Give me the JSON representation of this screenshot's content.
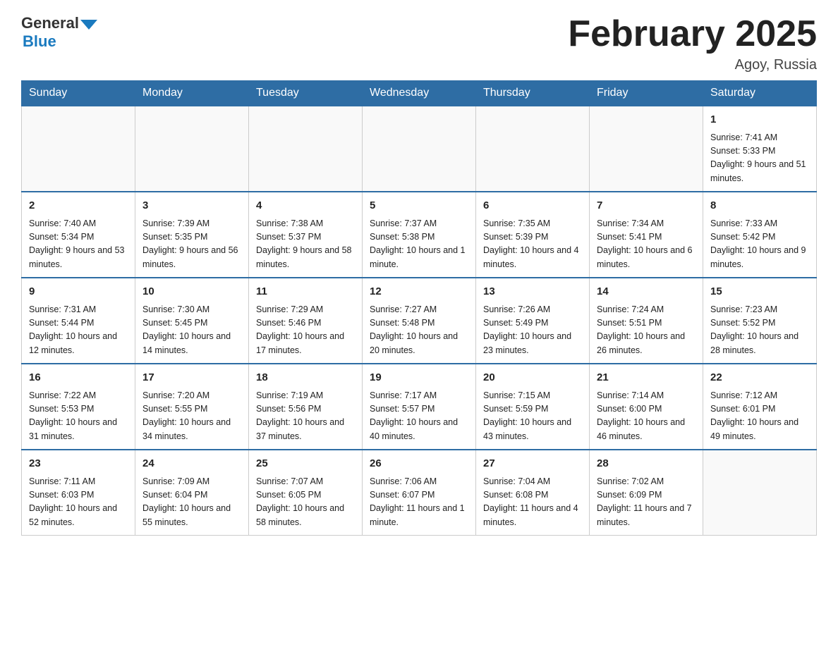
{
  "logo": {
    "general": "General",
    "blue": "Blue"
  },
  "title": "February 2025",
  "subtitle": "Agoy, Russia",
  "days_of_week": [
    "Sunday",
    "Monday",
    "Tuesday",
    "Wednesday",
    "Thursday",
    "Friday",
    "Saturday"
  ],
  "weeks": [
    [
      {
        "day": "",
        "info": ""
      },
      {
        "day": "",
        "info": ""
      },
      {
        "day": "",
        "info": ""
      },
      {
        "day": "",
        "info": ""
      },
      {
        "day": "",
        "info": ""
      },
      {
        "day": "",
        "info": ""
      },
      {
        "day": "1",
        "info": "Sunrise: 7:41 AM\nSunset: 5:33 PM\nDaylight: 9 hours\nand 51 minutes."
      }
    ],
    [
      {
        "day": "2",
        "info": "Sunrise: 7:40 AM\nSunset: 5:34 PM\nDaylight: 9 hours\nand 53 minutes."
      },
      {
        "day": "3",
        "info": "Sunrise: 7:39 AM\nSunset: 5:35 PM\nDaylight: 9 hours\nand 56 minutes."
      },
      {
        "day": "4",
        "info": "Sunrise: 7:38 AM\nSunset: 5:37 PM\nDaylight: 9 hours\nand 58 minutes."
      },
      {
        "day": "5",
        "info": "Sunrise: 7:37 AM\nSunset: 5:38 PM\nDaylight: 10 hours\nand 1 minute."
      },
      {
        "day": "6",
        "info": "Sunrise: 7:35 AM\nSunset: 5:39 PM\nDaylight: 10 hours\nand 4 minutes."
      },
      {
        "day": "7",
        "info": "Sunrise: 7:34 AM\nSunset: 5:41 PM\nDaylight: 10 hours\nand 6 minutes."
      },
      {
        "day": "8",
        "info": "Sunrise: 7:33 AM\nSunset: 5:42 PM\nDaylight: 10 hours\nand 9 minutes."
      }
    ],
    [
      {
        "day": "9",
        "info": "Sunrise: 7:31 AM\nSunset: 5:44 PM\nDaylight: 10 hours\nand 12 minutes."
      },
      {
        "day": "10",
        "info": "Sunrise: 7:30 AM\nSunset: 5:45 PM\nDaylight: 10 hours\nand 14 minutes."
      },
      {
        "day": "11",
        "info": "Sunrise: 7:29 AM\nSunset: 5:46 PM\nDaylight: 10 hours\nand 17 minutes."
      },
      {
        "day": "12",
        "info": "Sunrise: 7:27 AM\nSunset: 5:48 PM\nDaylight: 10 hours\nand 20 minutes."
      },
      {
        "day": "13",
        "info": "Sunrise: 7:26 AM\nSunset: 5:49 PM\nDaylight: 10 hours\nand 23 minutes."
      },
      {
        "day": "14",
        "info": "Sunrise: 7:24 AM\nSunset: 5:51 PM\nDaylight: 10 hours\nand 26 minutes."
      },
      {
        "day": "15",
        "info": "Sunrise: 7:23 AM\nSunset: 5:52 PM\nDaylight: 10 hours\nand 28 minutes."
      }
    ],
    [
      {
        "day": "16",
        "info": "Sunrise: 7:22 AM\nSunset: 5:53 PM\nDaylight: 10 hours\nand 31 minutes."
      },
      {
        "day": "17",
        "info": "Sunrise: 7:20 AM\nSunset: 5:55 PM\nDaylight: 10 hours\nand 34 minutes."
      },
      {
        "day": "18",
        "info": "Sunrise: 7:19 AM\nSunset: 5:56 PM\nDaylight: 10 hours\nand 37 minutes."
      },
      {
        "day": "19",
        "info": "Sunrise: 7:17 AM\nSunset: 5:57 PM\nDaylight: 10 hours\nand 40 minutes."
      },
      {
        "day": "20",
        "info": "Sunrise: 7:15 AM\nSunset: 5:59 PM\nDaylight: 10 hours\nand 43 minutes."
      },
      {
        "day": "21",
        "info": "Sunrise: 7:14 AM\nSunset: 6:00 PM\nDaylight: 10 hours\nand 46 minutes."
      },
      {
        "day": "22",
        "info": "Sunrise: 7:12 AM\nSunset: 6:01 PM\nDaylight: 10 hours\nand 49 minutes."
      }
    ],
    [
      {
        "day": "23",
        "info": "Sunrise: 7:11 AM\nSunset: 6:03 PM\nDaylight: 10 hours\nand 52 minutes."
      },
      {
        "day": "24",
        "info": "Sunrise: 7:09 AM\nSunset: 6:04 PM\nDaylight: 10 hours\nand 55 minutes."
      },
      {
        "day": "25",
        "info": "Sunrise: 7:07 AM\nSunset: 6:05 PM\nDaylight: 10 hours\nand 58 minutes."
      },
      {
        "day": "26",
        "info": "Sunrise: 7:06 AM\nSunset: 6:07 PM\nDaylight: 11 hours\nand 1 minute."
      },
      {
        "day": "27",
        "info": "Sunrise: 7:04 AM\nSunset: 6:08 PM\nDaylight: 11 hours\nand 4 minutes."
      },
      {
        "day": "28",
        "info": "Sunrise: 7:02 AM\nSunset: 6:09 PM\nDaylight: 11 hours\nand 7 minutes."
      },
      {
        "day": "",
        "info": ""
      }
    ]
  ]
}
